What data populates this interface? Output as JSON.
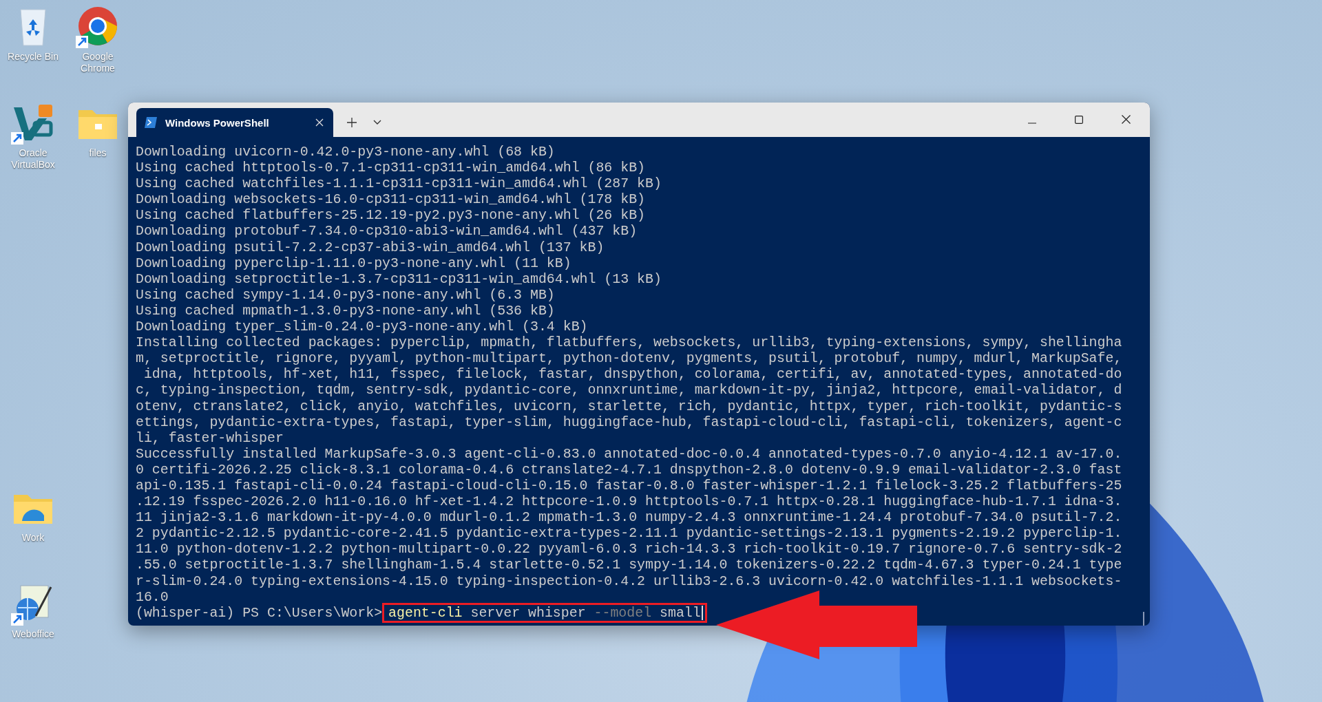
{
  "desktop_icons": [
    {
      "label": "Recycle Bin",
      "kind": "recycle-bin",
      "shortcut": false
    },
    {
      "label": "Google Chrome",
      "kind": "browser",
      "shortcut": true
    },
    {
      "label": "Oracle VirtualBox",
      "kind": "virtualbox",
      "shortcut": true
    },
    {
      "label": "files",
      "kind": "folder",
      "shortcut": false
    },
    {
      "label": "Work",
      "kind": "folder-special",
      "shortcut": false
    },
    {
      "label": "Weboffice",
      "kind": "weboffice",
      "shortcut": true
    }
  ],
  "window": {
    "tabs": [
      {
        "title": "Windows PowerShell",
        "selected": true
      }
    ]
  },
  "terminal": {
    "lines": [
      "Downloading uvicorn-0.42.0-py3-none-any.whl (68 kB)",
      "Using cached httptools-0.7.1-cp311-cp311-win_amd64.whl (86 kB)",
      "Using cached watchfiles-1.1.1-cp311-cp311-win_amd64.whl (287 kB)",
      "Downloading websockets-16.0-cp311-cp311-win_amd64.whl (178 kB)",
      "Using cached flatbuffers-25.12.19-py2.py3-none-any.whl (26 kB)",
      "Downloading protobuf-7.34.0-cp310-abi3-win_amd64.whl (437 kB)",
      "Downloading psutil-7.2.2-cp37-abi3-win_amd64.whl (137 kB)",
      "Downloading pyperclip-1.11.0-py3-none-any.whl (11 kB)",
      "Downloading setproctitle-1.3.7-cp311-cp311-win_amd64.whl (13 kB)",
      "Using cached sympy-1.14.0-py3-none-any.whl (6.3 MB)",
      "Using cached mpmath-1.3.0-py3-none-any.whl (536 kB)",
      "Downloading typer_slim-0.24.0-py3-none-any.whl (3.4 kB)",
      "Installing collected packages: pyperclip, mpmath, flatbuffers, websockets, urllib3, typing-extensions, sympy, shellingha",
      "m, setproctitle, rignore, pyyaml, python-multipart, python-dotenv, pygments, psutil, protobuf, numpy, mdurl, MarkupSafe,",
      " idna, httptools, hf-xet, h11, fsspec, filelock, fastar, dnspython, colorama, certifi, av, annotated-types, annotated-do",
      "c, typing-inspection, tqdm, sentry-sdk, pydantic-core, onnxruntime, markdown-it-py, jinja2, httpcore, email-validator, d",
      "otenv, ctranslate2, click, anyio, watchfiles, uvicorn, starlette, rich, pydantic, httpx, typer, rich-toolkit, pydantic-s",
      "ettings, pydantic-extra-types, fastapi, typer-slim, huggingface-hub, fastapi-cloud-cli, fastapi-cli, tokenizers, agent-c",
      "li, faster-whisper",
      "Successfully installed MarkupSafe-3.0.3 agent-cli-0.83.0 annotated-doc-0.0.4 annotated-types-0.7.0 anyio-4.12.1 av-17.0.",
      "0 certifi-2026.2.25 click-8.3.1 colorama-0.4.6 ctranslate2-4.7.1 dnspython-2.8.0 dotenv-0.9.9 email-validator-2.3.0 fast",
      "api-0.135.1 fastapi-cli-0.0.24 fastapi-cloud-cli-0.15.0 fastar-0.8.0 faster-whisper-1.2.1 filelock-3.25.2 flatbuffers-25",
      ".12.19 fsspec-2026.2.0 h11-0.16.0 hf-xet-1.4.2 httpcore-1.0.9 httptools-0.7.1 httpx-0.28.1 huggingface-hub-1.7.1 idna-3.",
      "11 jinja2-3.1.6 markdown-it-py-4.0.0 mdurl-0.1.2 mpmath-1.3.0 numpy-2.4.3 onnxruntime-1.24.4 protobuf-7.34.0 psutil-7.2.",
      "2 pydantic-2.12.5 pydantic-core-2.41.5 pydantic-extra-types-2.11.1 pydantic-settings-2.13.1 pygments-2.19.2 pyperclip-1.",
      "11.0 python-dotenv-1.2.2 python-multipart-0.0.22 pyyaml-6.0.3 rich-14.3.3 rich-toolkit-0.19.7 rignore-0.7.6 sentry-sdk-2",
      ".55.0 setproctitle-1.3.7 shellingham-1.5.4 starlette-0.52.1 sympy-1.14.0 tokenizers-0.22.2 tqdm-4.67.3 typer-0.24.1 type",
      "r-slim-0.24.0 typing-extensions-4.15.0 typing-inspection-0.4.2 urllib3-2.6.3 uvicorn-0.42.0 watchfiles-1.1.1 websockets-",
      "16.0"
    ],
    "prompt": "(whisper-ai) PS C:\\Users\\Work>",
    "command": [
      {
        "text": "agent-cli",
        "kind": "command"
      },
      {
        "text": "server",
        "kind": "argument"
      },
      {
        "text": "whisper",
        "kind": "argument"
      },
      {
        "text": "--model",
        "kind": "parameter"
      },
      {
        "text": "small",
        "kind": "argument"
      }
    ],
    "highlighted": true
  }
}
